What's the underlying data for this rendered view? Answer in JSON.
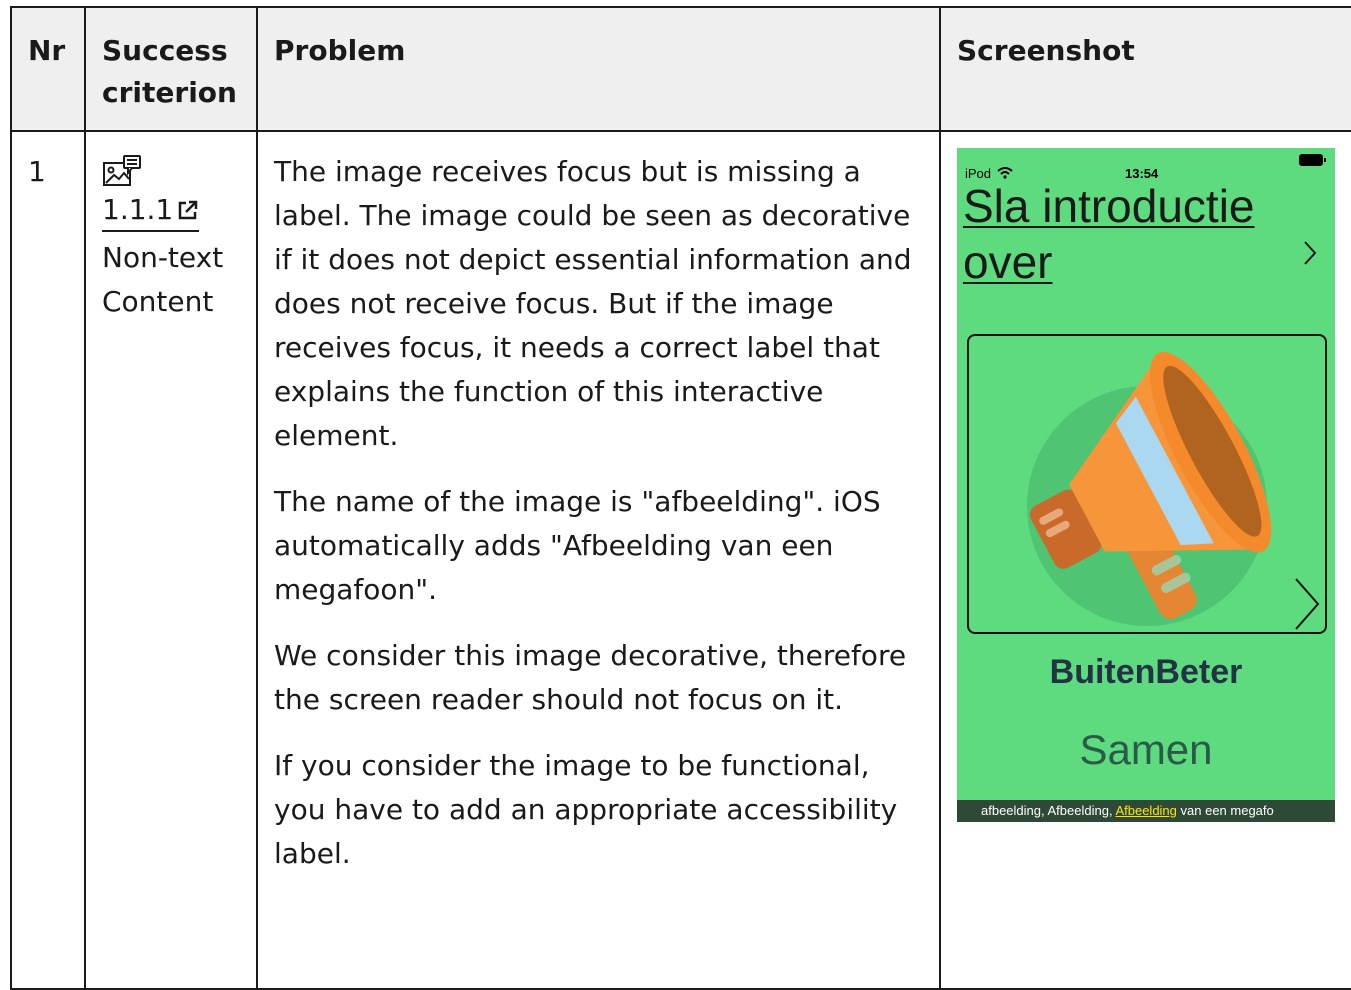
{
  "table": {
    "headers": {
      "nr": "Nr",
      "criterion": "Success criterion",
      "problem": "Problem",
      "screenshot": "Screenshot"
    },
    "rows": [
      {
        "nr": "1",
        "criterion_number": "1.1.1",
        "criterion_name": "Non-text Content",
        "problem_paragraphs": [
          "The image receives focus but is missing a label. The image could be seen as decorative if it does not depict essential information and does not receive focus. But if the image receives focus, it needs a correct label that explains the function of this interactive element.",
          "The name of the image is \"afbeelding\". iOS automatically adds \"Afbeelding van een megafoon\".",
          "We consider this image decorative, therefore the screen reader should not focus on it.",
          "If you consider the image to be functional, you have to add an appropriate accessibility label."
        ],
        "screenshot": {
          "status_left": "iPod",
          "status_time": "13:54",
          "intro_link": "Sla introductie over",
          "app_title": "BuitenBeter",
          "app_subtitle": "Samen",
          "voiceover_before": "afbeelding, Afbeelding, ",
          "voiceover_highlight": "Afbeelding",
          "voiceover_after": " van een megafo",
          "icons": {
            "wifi": "wifi-icon",
            "battery": "battery-icon",
            "next": "chevron-right-icon",
            "image": "megaphone-image"
          },
          "colors": {
            "background": "#5edb7e",
            "megaphone": "#f7953b",
            "voiceover_bar": "#2e4a36"
          }
        }
      }
    ]
  }
}
